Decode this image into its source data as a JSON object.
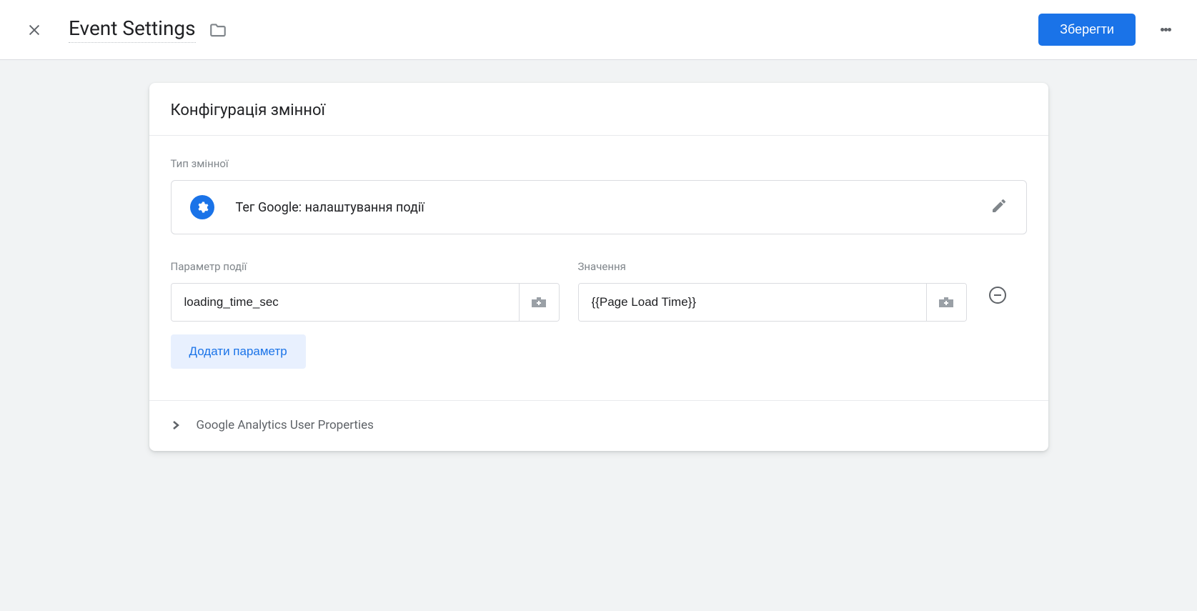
{
  "header": {
    "title": "Event Settings",
    "save_label": "Зберегти"
  },
  "card": {
    "title": "Конфігурація змінної",
    "variable_type_label": "Тип змінної",
    "variable_type_name": "Тег Google: налаштування події",
    "param_label": "Параметр події",
    "value_label": "Значення",
    "rows": [
      {
        "param": "loading_time_sec",
        "value": "{{Page Load Time}}"
      }
    ],
    "add_param_label": "Додати параметр",
    "user_properties_label": "Google Analytics User Properties"
  }
}
